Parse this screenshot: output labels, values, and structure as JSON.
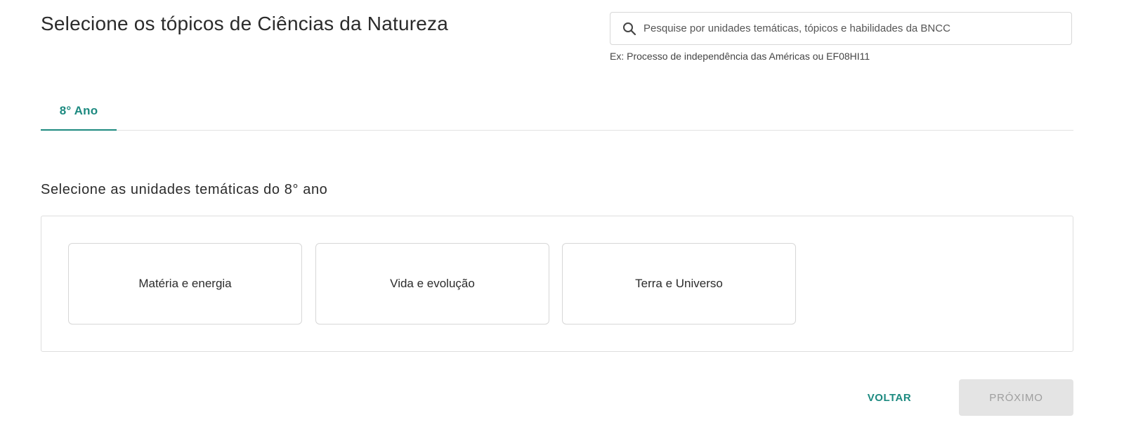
{
  "header": {
    "title": "Selecione os tópicos de Ciências da Natureza"
  },
  "search": {
    "placeholder": "Pesquise por unidades temáticas, tópicos e habilidades da BNCC",
    "value": "",
    "hint": "Ex: Processo de independência das Américas ou EF08HI11",
    "icon": "search-icon"
  },
  "tabs": [
    {
      "label": "8° Ano",
      "active": true
    }
  ],
  "units": {
    "title": "Selecione as unidades temáticas do 8° ano",
    "items": [
      {
        "label": "Matéria e energia"
      },
      {
        "label": "Vida e evolução"
      },
      {
        "label": "Terra e Universo"
      }
    ]
  },
  "footer": {
    "back_label": "VOLTAR",
    "next_label": "PRÓXIMO",
    "next_disabled": true
  },
  "colors": {
    "accent": "#1d8a80",
    "disabled_bg": "#e4e4e4",
    "disabled_text": "#9e9e9e",
    "border": "#d7d7d7"
  }
}
